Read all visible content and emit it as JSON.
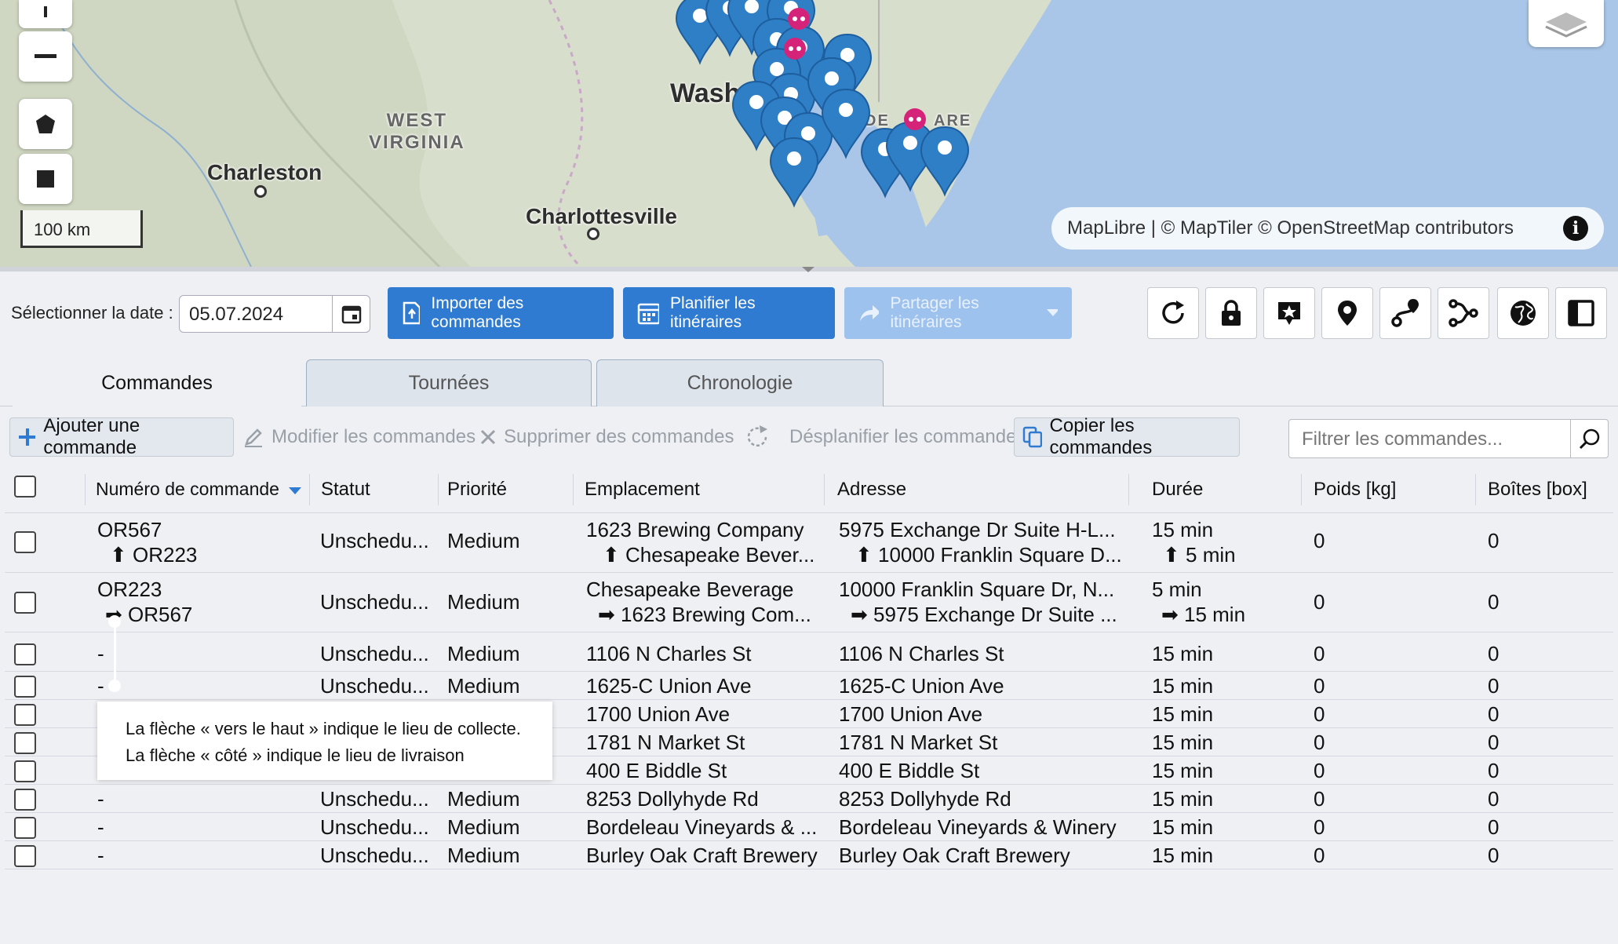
{
  "map": {
    "cities": [
      "Charleston",
      "Charlottesville",
      "Wash"
    ],
    "states": [
      "WEST",
      "VIRGINIA",
      "DE",
      "ARE"
    ],
    "scale_label": "100 km",
    "attribution": "MapLibre | © MapTiler © OpenStreetMap contributors",
    "controls": [
      "zoom-in",
      "zoom-out",
      "polygon-tool",
      "rectangle-tool",
      "layers"
    ]
  },
  "toolbar": {
    "date_label": "Sélectionner la date :",
    "date_value": "05.07.2024",
    "import_label": "Importer des commandes",
    "plan_label": "Planifier les itinéraires",
    "share_label": "Partager les itinéraires",
    "icons": [
      "refresh-icon",
      "lock-icon",
      "star-marker-icon",
      "location-pin-icon",
      "route-icon",
      "route-split-icon",
      "globe-icon",
      "panel-toggle-icon"
    ]
  },
  "tabs": [
    {
      "label": "Commandes",
      "active": true
    },
    {
      "label": "Tournées",
      "active": false
    },
    {
      "label": "Chronologie",
      "active": false
    }
  ],
  "actions": {
    "add": "Ajouter une commande",
    "edit": "Modifier les commandes",
    "delete": "Supprimer des commandes",
    "unplan": "Désplanifier les commandes",
    "copy": "Copier les commandes",
    "filter_placeholder": "Filtrer les commandes..."
  },
  "table": {
    "columns": [
      "Numéro de commande",
      "Statut",
      "Priorité",
      "Emplacement",
      "Adresse",
      "Durée",
      "Poids [kg]",
      "Boîtes [box]"
    ],
    "rows": [
      {
        "order": "OR567",
        "order_sub": "⬆ OR223",
        "status": "Unschedu...",
        "priority": "Medium",
        "location": "1623 Brewing Company",
        "location_sub": "⬆ Chesapeake Bever...",
        "address": "5975 Exchange Dr Suite H-L...",
        "address_sub": "⬆ 10000 Franklin Square D...",
        "duration": "15 min",
        "duration_sub": "⬆ 5 min",
        "weight": "0",
        "boxes": "0"
      },
      {
        "order": "OR223",
        "order_sub": "➡ OR567",
        "status": "Unschedu...",
        "priority": "Medium",
        "location": "Chesapeake Beverage",
        "location_sub": "➡ 1623 Brewing Com...",
        "address": "10000 Franklin Square Dr, N...",
        "address_sub": "➡ 5975 Exchange Dr Suite ...",
        "duration": "5 min",
        "duration_sub": "➡ 15 min",
        "weight": "0",
        "boxes": "0"
      },
      {
        "order": "-",
        "status": "Unschedu...",
        "priority": "Medium",
        "location": "1106 N Charles St",
        "address": "1106 N Charles St",
        "duration": "15 min",
        "weight": "0",
        "boxes": "0"
      },
      {
        "order": "-",
        "status": "Unschedu...",
        "priority": "Medium",
        "location": "1625-C Union Ave",
        "address": "1625-C Union Ave",
        "duration": "15 min",
        "weight": "0",
        "boxes": "0"
      },
      {
        "order": "",
        "status": "",
        "priority": "",
        "location": "1700 Union Ave",
        "address": "1700 Union Ave",
        "duration": "15 min",
        "weight": "0",
        "boxes": "0"
      },
      {
        "order": "",
        "status": "",
        "priority": "",
        "location": "1781 N Market St",
        "address": "1781 N Market St",
        "duration": "15 min",
        "weight": "0",
        "boxes": "0"
      },
      {
        "order": "-",
        "status": "Unschedu...",
        "priority": "Medium",
        "location": "400 E Biddle St",
        "address": "400 E Biddle St",
        "duration": "15 min",
        "weight": "0",
        "boxes": "0"
      },
      {
        "order": "-",
        "status": "Unschedu...",
        "priority": "Medium",
        "location": "8253 Dollyhyde Rd",
        "address": "8253 Dollyhyde Rd",
        "duration": "15 min",
        "weight": "0",
        "boxes": "0"
      },
      {
        "order": "-",
        "status": "Unschedu...",
        "priority": "Medium",
        "location": "Bordeleau Vineyards & ...",
        "address": "Bordeleau Vineyards & Winery",
        "duration": "15 min",
        "weight": "0",
        "boxes": "0"
      },
      {
        "order": "-",
        "status": "Unschedu...",
        "priority": "Medium",
        "location": "Burley Oak Craft Brewery",
        "address": "Burley Oak Craft Brewery",
        "duration": "15 min",
        "weight": "0",
        "boxes": "0"
      }
    ]
  },
  "tooltip": {
    "line1": "La flèche « vers le haut » indique le lieu de collecte.",
    "line2": "La flèche « côté » indique le lieu de livraison"
  },
  "colors": {
    "primary": "#2e7bd1",
    "pin": "#2f7fc6",
    "pin_alert": "#d6237a",
    "water": "#a9c6e8"
  }
}
